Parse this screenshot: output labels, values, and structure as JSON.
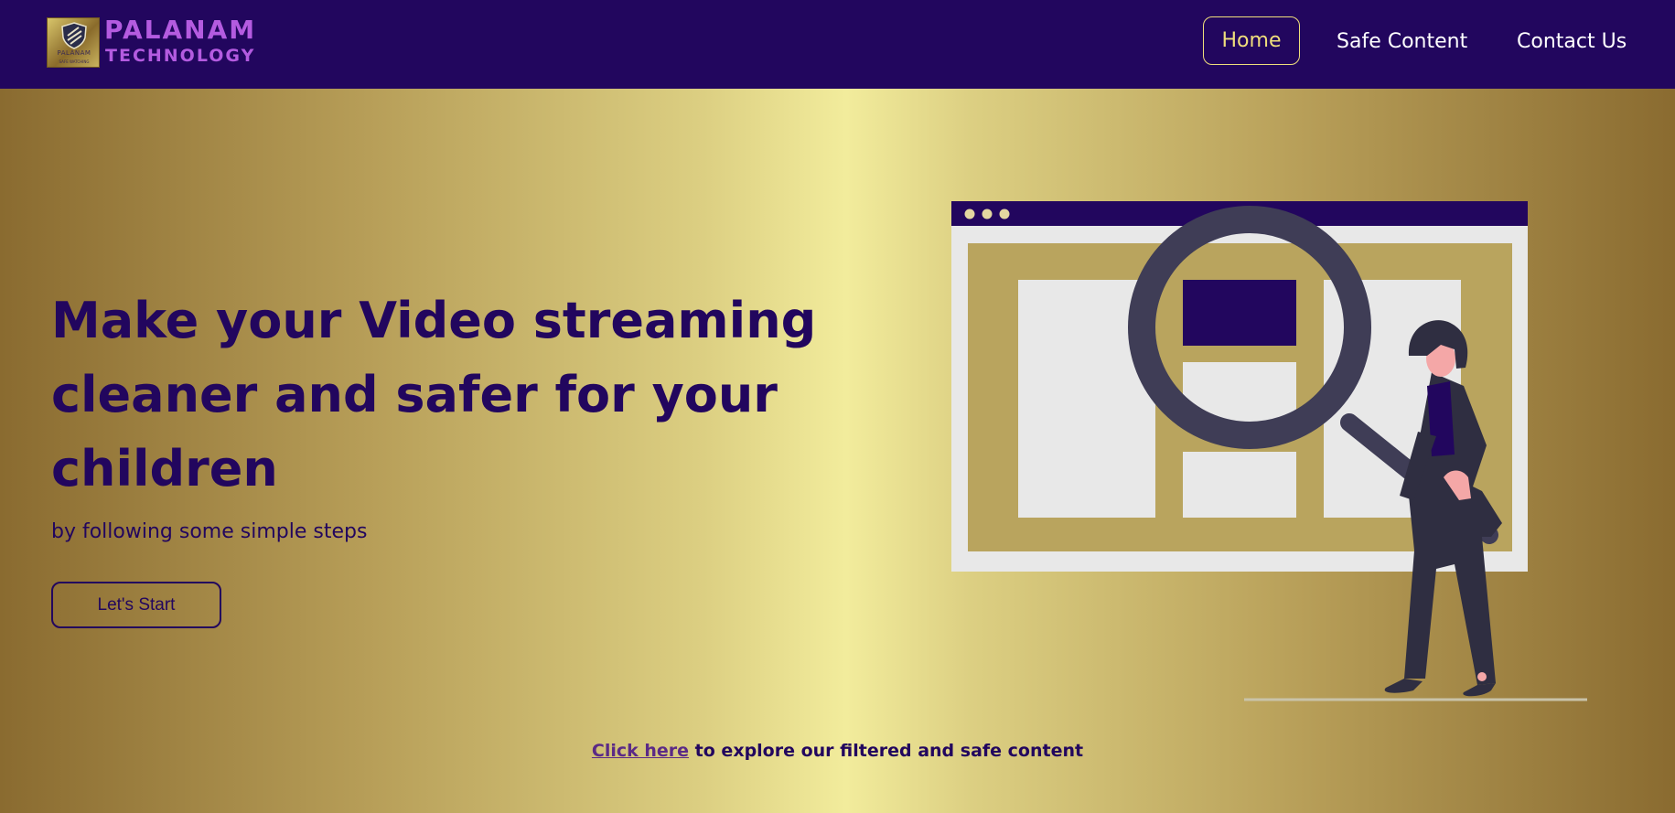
{
  "colors": {
    "navbar_bg": "#22065e",
    "brand_text": "#b45be0",
    "active_nav": "#f0de7c",
    "headline": "#22065e",
    "gold_light": "#f2ec9c",
    "gold_dark": "#8a6b30"
  },
  "brand": {
    "badge_text": "PALANAM",
    "badge_subtext": "SAFE WATCHING",
    "name": "PALANAM",
    "subtitle": "TECHNOLOGY"
  },
  "nav": {
    "items": [
      {
        "label": "Home",
        "active": true
      },
      {
        "label": "Safe Content",
        "active": false
      },
      {
        "label": "Contact Us",
        "active": false
      }
    ]
  },
  "hero": {
    "headline": "Make your Video streaming cleaner and safer for your children",
    "subline": "by following some simple steps",
    "cta_label": "Let's Start",
    "illustration_icon": "magnifying-glass-browser-person"
  },
  "footer": {
    "link_text": "Click here",
    "rest_text": " to explore our filtered and safe content"
  }
}
